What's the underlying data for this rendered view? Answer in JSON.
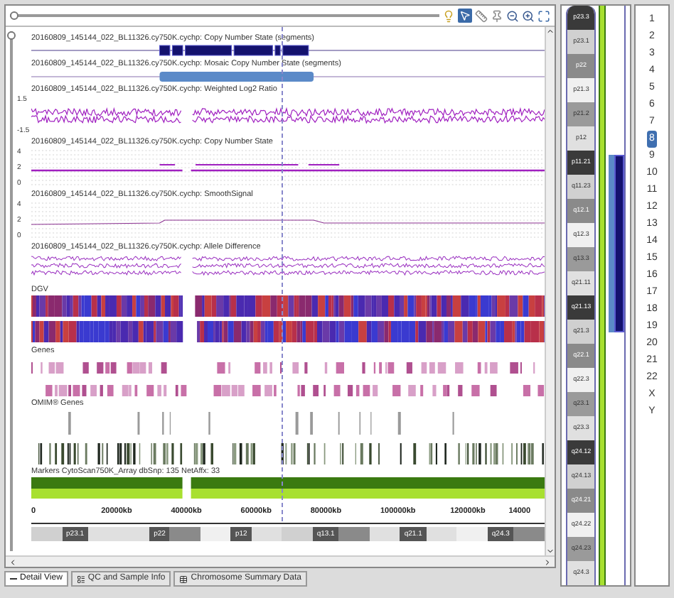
{
  "zoom_slider": {
    "level": 0
  },
  "vertical_zoom_slider": {
    "level": 0
  },
  "tracks": [
    {
      "kind": "segments",
      "title": "20160809_145144_022_BL11326.cy750K.cychp: Copy Number State (segments)"
    },
    {
      "kind": "mosaic",
      "title": "20160809_145144_022_BL11326.cy750K.cychp: Mosaic Copy Number State (segments)"
    },
    {
      "kind": "log2",
      "title": "20160809_145144_022_BL11326.cy750K.cychp: Weighted Log2 Ratio",
      "axis": [
        "1.5",
        "-1.5"
      ]
    },
    {
      "kind": "cnstate",
      "title": "20160809_145144_022_BL11326.cy750K.cychp: Copy Number State",
      "axis": [
        "4",
        "2",
        "0"
      ]
    },
    {
      "kind": "smooth",
      "title": "20160809_145144_022_BL11326.cy750K.cychp: SmoothSignal",
      "axis": [
        "4",
        "2",
        "0"
      ]
    },
    {
      "kind": "allele",
      "title": "20160809_145144_022_BL11326.cy750K.cychp: Allele Difference"
    },
    {
      "kind": "dgv",
      "title": "DGV"
    },
    {
      "kind": "genes",
      "title": "Genes"
    },
    {
      "kind": "omim",
      "title": "OMIM® Genes"
    },
    {
      "kind": "markers",
      "title": "Markers CytoScan750K_Array dbSnp: 135 NetAffx: 33"
    }
  ],
  "ruler": [
    "0",
    "20000kb",
    "40000kb",
    "60000kb",
    "80000kb",
    "100000kb",
    "120000kb",
    "14000"
  ],
  "ideogram_bands": [
    "p23.1",
    "p22",
    "p12",
    "q13.1",
    "q21.1",
    "q24.3"
  ],
  "chromosome_bands": [
    "p23.3",
    "p23.1",
    "p22",
    "p21.3",
    "p21.2",
    "p12",
    "p11.21",
    "q11.23",
    "q12.1",
    "q12.3",
    "q13.3",
    "q21.11",
    "q21.13",
    "q21.3",
    "q22.1",
    "q22.3",
    "q23.1",
    "q23.3",
    "q24.12",
    "q24.13",
    "q24.21",
    "q24.22",
    "q24.23",
    "q24.3"
  ],
  "chromosomes": [
    {
      "label": "1",
      "selected": false
    },
    {
      "label": "2",
      "selected": false
    },
    {
      "label": "3",
      "selected": false
    },
    {
      "label": "4",
      "selected": false
    },
    {
      "label": "5",
      "selected": false
    },
    {
      "label": "6",
      "selected": false
    },
    {
      "label": "7",
      "selected": false
    },
    {
      "label": "8",
      "selected": true
    },
    {
      "label": "9",
      "selected": false
    },
    {
      "label": "10",
      "selected": false
    },
    {
      "label": "11",
      "selected": false
    },
    {
      "label": "12",
      "selected": false
    },
    {
      "label": "13",
      "selected": false
    },
    {
      "label": "14",
      "selected": false
    },
    {
      "label": "15",
      "selected": false
    },
    {
      "label": "16",
      "selected": false
    },
    {
      "label": "17",
      "selected": false
    },
    {
      "label": "18",
      "selected": false
    },
    {
      "label": "19",
      "selected": false
    },
    {
      "label": "20",
      "selected": false
    },
    {
      "label": "21",
      "selected": false
    },
    {
      "label": "22",
      "selected": false
    },
    {
      "label": "X",
      "selected": false
    },
    {
      "label": "Y",
      "selected": false
    }
  ],
  "tabs": [
    {
      "label": "Detail View",
      "selected": true
    },
    {
      "label": "QC and Sample Info",
      "selected": false
    },
    {
      "label": "Chromosome Summary Data",
      "selected": false
    }
  ]
}
